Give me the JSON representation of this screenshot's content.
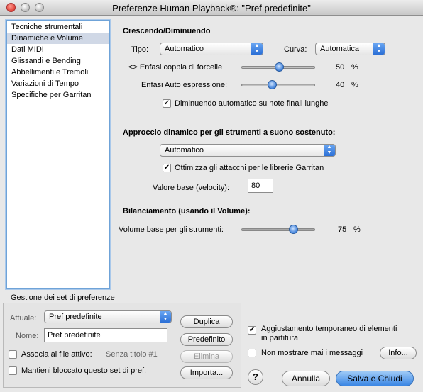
{
  "window": {
    "title": "Preferenze Human Playback®: \"Pref predefinite\""
  },
  "sidebar": {
    "items": [
      {
        "label": "Tecniche strumentali",
        "selected": false
      },
      {
        "label": "Dinamiche e Volume",
        "selected": true
      },
      {
        "label": "Dati MIDI",
        "selected": false
      },
      {
        "label": "Glissandi e Bending",
        "selected": false
      },
      {
        "label": "Abbellimenti e Tremoli",
        "selected": false
      },
      {
        "label": "Variazioni di Tempo",
        "selected": false
      },
      {
        "label": "Specifiche per Garritan",
        "selected": false
      }
    ]
  },
  "crescendo": {
    "heading": "Crescendo/Diminuendo",
    "tipo_label": "Tipo:",
    "tipo_value": "Automatico",
    "curva_label": "Curva:",
    "curva_value": "Automatica",
    "forcelle_label": "<> Enfasi coppia di forcelle",
    "forcelle_value": "50",
    "forcelle_unit": "%",
    "auto_label": "Enfasi Auto espressione:",
    "auto_value": "40",
    "auto_unit": "%",
    "dim_label": "Diminuendo automatico su note finali lunghe",
    "dim_checked": true
  },
  "approccio": {
    "heading": "Approccio dinamico per gli strumenti a suono sostenuto:",
    "mode_value": "Automatico",
    "garritan_label": "Ottimizza gli attacchi per le librerie Garritan",
    "garritan_checked": true,
    "velocity_label": "Valore base (velocity):",
    "velocity_value": "80"
  },
  "bilanciamento": {
    "heading": "Bilanciamento (usando il Volume):",
    "volume_label": "Volume base per gli strumenti:",
    "volume_value": "75",
    "volume_unit": "%"
  },
  "gestione": {
    "heading": "Gestione dei set di preferenze",
    "attuale_label": "Attuale:",
    "attuale_value": "Pref predefinite",
    "nome_label": "Nome:",
    "nome_value": "Pref predefinite",
    "associa_label": "Associa al file attivo:",
    "associa_file": "Senza titolo #1",
    "mantieni_label": "Mantieni bloccato questo set di pref.",
    "duplica": "Duplica",
    "predefinito": "Predefinito",
    "elimina": "Elimina",
    "importa": "Importa..."
  },
  "options": {
    "aggiust_line1": "Aggiustamento temporaneo di elementi",
    "aggiust_line2": "in partitura",
    "aggiust_checked": true,
    "nonmostrare_label": "Non mostrare mai i messaggi",
    "nonmostrare_checked": false,
    "info": "Info..."
  },
  "footer": {
    "help": "?",
    "cancel": "Annulla",
    "save": "Salva e Chiudi"
  },
  "icons": {
    "popup_arrow": "up-down-arrows",
    "check": "checkmark"
  }
}
